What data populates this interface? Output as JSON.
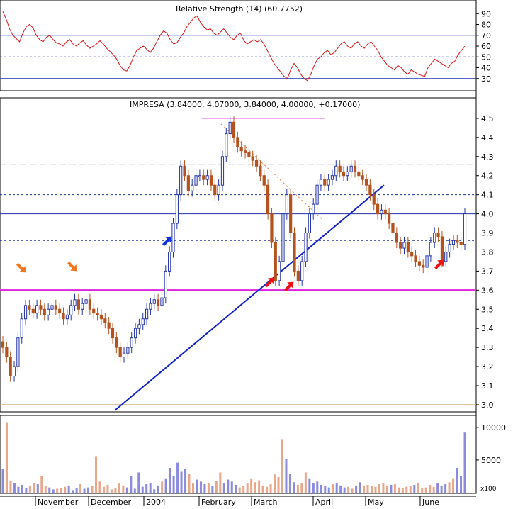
{
  "chart_data": [
    {
      "type": "line",
      "panel": "indicator",
      "title": "Relative Strength (14) (60.7752)",
      "ylim": [
        20,
        100
      ],
      "yticks": [
        30,
        40,
        50,
        60,
        70,
        80,
        90
      ],
      "reference_lines": [
        {
          "value": 30,
          "style": "solid"
        },
        {
          "value": 50,
          "style": "dotted"
        },
        {
          "value": 70,
          "style": "solid"
        }
      ],
      "color": "#dd1111",
      "series": [
        {
          "values": [
            92,
            85,
            76,
            70,
            67,
            64,
            72,
            78,
            80,
            77,
            70,
            66,
            64,
            68,
            70,
            66,
            63,
            62,
            60,
            64,
            66,
            62,
            60,
            63,
            65,
            61,
            58,
            60,
            62,
            65,
            62,
            58,
            55,
            52,
            48,
            42,
            38,
            37,
            42,
            50,
            56,
            58,
            60,
            57,
            54,
            58,
            64,
            70,
            74,
            72,
            66,
            62,
            63,
            68,
            72,
            78,
            82,
            86,
            88,
            82,
            78,
            75,
            76,
            72,
            70,
            73,
            76,
            72,
            68,
            66,
            70,
            72,
            65,
            62,
            64,
            66,
            64,
            66,
            62,
            56,
            50,
            44,
            40,
            36,
            32,
            30,
            38,
            44,
            40,
            34,
            30,
            28,
            34,
            42,
            48,
            50,
            54,
            56,
            52,
            54,
            58,
            62,
            64,
            60,
            58,
            62,
            64,
            60,
            58,
            62,
            64,
            60,
            56,
            50,
            46,
            42,
            40,
            38,
            42,
            40,
            36,
            34,
            38,
            36,
            34,
            33,
            32,
            40,
            44,
            48,
            46,
            44,
            42,
            40,
            44,
            46,
            52,
            56,
            60
          ]
        }
      ]
    },
    {
      "type": "candlestick",
      "panel": "price",
      "title": "IMPRESA (3.84000, 4.07000, 3.84000, 4.00000, +0.17000)",
      "ylim": [
        2.97,
        4.6
      ],
      "yticks": [
        3.0,
        3.1,
        3.2,
        3.3,
        3.4,
        3.5,
        3.6,
        3.7,
        3.8,
        3.9,
        4.0,
        4.1,
        4.2,
        4.3,
        4.4,
        4.5
      ],
      "up_color": "#2233aa",
      "down_color": "#b4531f",
      "close": [
        3.3,
        3.25,
        3.15,
        3.2,
        3.35,
        3.45,
        3.52,
        3.5,
        3.48,
        3.52,
        3.5,
        3.47,
        3.5,
        3.52,
        3.5,
        3.48,
        3.45,
        3.47,
        3.52,
        3.55,
        3.5,
        3.53,
        3.55,
        3.5,
        3.48,
        3.47,
        3.45,
        3.43,
        3.4,
        3.35,
        3.3,
        3.25,
        3.27,
        3.3,
        3.35,
        3.4,
        3.42,
        3.45,
        3.5,
        3.53,
        3.55,
        3.52,
        3.56,
        3.7,
        3.8,
        3.95,
        4.1,
        4.25,
        4.2,
        4.12,
        4.15,
        4.2,
        4.2,
        4.18,
        4.2,
        4.15,
        4.1,
        4.15,
        4.3,
        4.42,
        4.48,
        4.4,
        4.35,
        4.33,
        4.32,
        4.3,
        4.28,
        4.25,
        4.2,
        4.15,
        4.0,
        3.85,
        3.65,
        3.75,
        4.0,
        4.1,
        3.9,
        3.7,
        3.65,
        3.75,
        3.9,
        4.0,
        4.05,
        4.15,
        4.18,
        4.15,
        4.18,
        4.2,
        4.25,
        4.22,
        4.2,
        4.22,
        4.25,
        4.22,
        4.2,
        4.18,
        4.15,
        4.1,
        4.05,
        4.0,
        4.02,
        4.0,
        3.95,
        3.9,
        3.85,
        3.82,
        3.85,
        3.8,
        3.78,
        3.75,
        3.73,
        3.72,
        3.78,
        3.85,
        3.9,
        3.88,
        3.75,
        3.8,
        3.84,
        3.86,
        3.85,
        3.84,
        4.0
      ]
    },
    {
      "type": "bar",
      "panel": "volume",
      "units_label": "x100",
      "ylim": [
        0,
        11500
      ],
      "yticks": [
        5000,
        10000
      ],
      "x_tick_labels": [
        "November",
        "December",
        "2004",
        "February",
        "March",
        "April",
        "May",
        "June"
      ],
      "values": [
        3600,
        10800,
        1800,
        1500,
        900,
        1200,
        700,
        1100,
        1500,
        1300,
        2600,
        1000,
        800,
        500,
        600,
        700,
        900,
        1100,
        400,
        700,
        1300,
        600,
        800,
        1000,
        5600,
        1700,
        900,
        1200,
        500,
        700,
        1400,
        1100,
        800,
        2600,
        600,
        3100,
        900,
        1300,
        1500,
        500,
        1100,
        1700,
        2200,
        3800,
        2600,
        4600,
        3200,
        3700,
        2900,
        1400,
        2000,
        1700,
        1300,
        1500,
        1000,
        1800,
        3100,
        1400,
        2000,
        1700,
        1200,
        800,
        1000,
        1400,
        2200,
        1600,
        1900,
        1100,
        900,
        1300,
        2800,
        2400,
        8200,
        5100,
        2900,
        1600,
        1200,
        1400,
        3100,
        2200,
        1500,
        1700,
        1200,
        1000,
        800,
        1300,
        1400,
        1100,
        800,
        900,
        600,
        1100,
        1600,
        1100,
        1200,
        1000,
        900,
        1300,
        1500,
        1100,
        1200,
        1300,
        800,
        700,
        900,
        1000,
        1200,
        1500,
        700,
        800,
        1200,
        900,
        1400,
        1100,
        1300,
        1600,
        2200,
        3800,
        2500,
        9200
      ]
    }
  ]
}
